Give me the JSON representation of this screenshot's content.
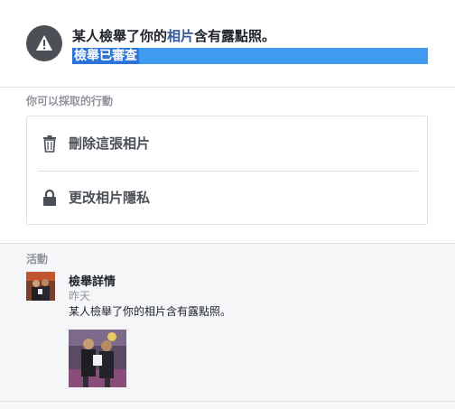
{
  "notice": {
    "title_prefix": "某人檢舉了你的",
    "title_link": "相片",
    "title_suffix": "含有露點照。",
    "status": "檢舉已審查",
    "icon": "warning-icon"
  },
  "actions": {
    "label": "你可以採取的行動",
    "items": [
      {
        "label": "刪除這張相片",
        "icon": "trash-icon"
      },
      {
        "label": "更改相片隱私",
        "icon": "lock-icon"
      }
    ]
  },
  "activity": {
    "label": "活動",
    "item": {
      "title": "檢舉詳情",
      "time": "昨天",
      "text": "某人檢舉了你的相片含有露點照。"
    }
  },
  "colors": {
    "link": "#365899",
    "highlight": "#3f9cf0",
    "icon": "#4b4f56"
  }
}
